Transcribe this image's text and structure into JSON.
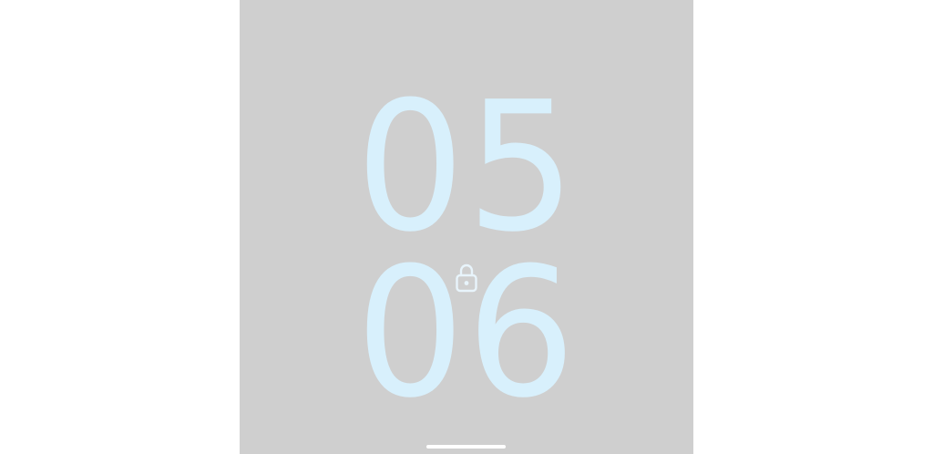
{
  "lockscreen": {
    "time_hours": "05",
    "time_minutes": "06",
    "lock_icon": "lock-icon"
  },
  "colors": {
    "background": "#cfcfcf",
    "clock": "#d8f0fc",
    "indicator": "#ffffff"
  }
}
